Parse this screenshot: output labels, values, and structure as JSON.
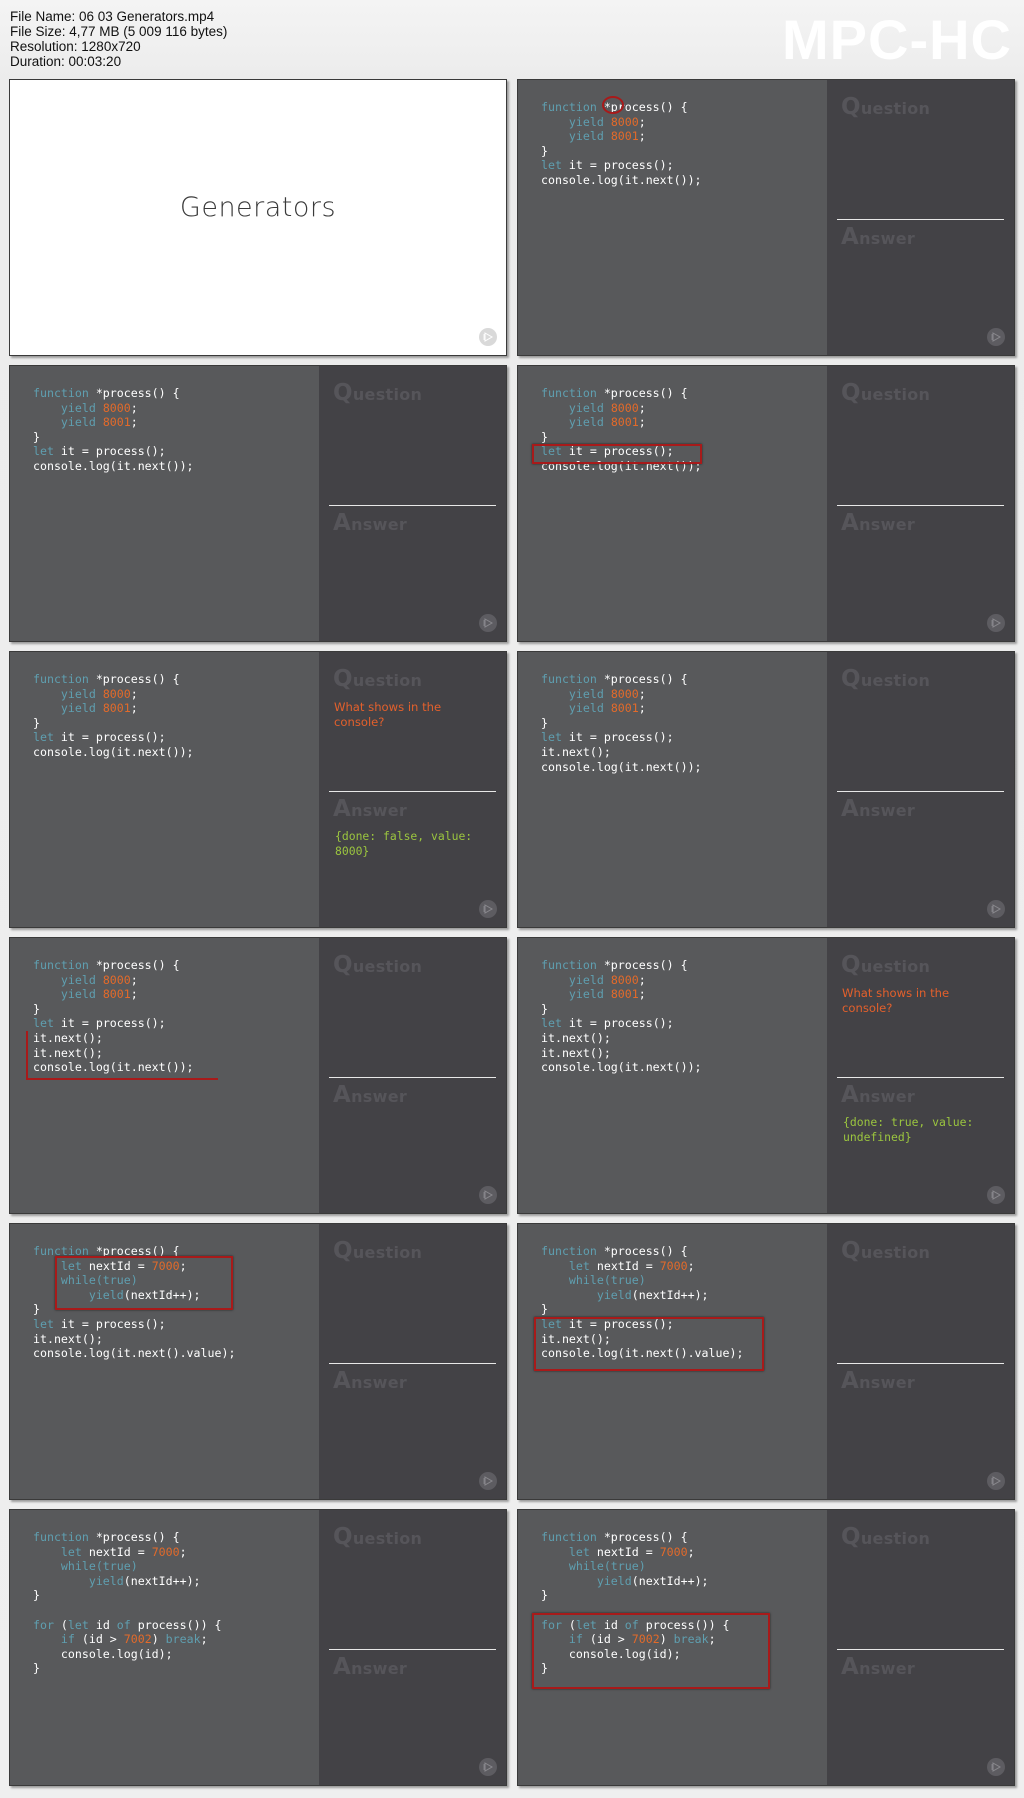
{
  "header": {
    "file_name": "File Name: 06 03 Generators.mp4",
    "file_size": "File Size: 4,77 MB (5 009 116 bytes)",
    "resolution": "Resolution: 1280x720",
    "duration": "Duration: 00:03:20",
    "logo": "MPC-HC"
  },
  "labels": {
    "question_initial": "Q",
    "question_rest": "uestion",
    "answer_initial": "A",
    "answer_rest": "nswer"
  },
  "colors": {
    "keyword": "#5f9fb0",
    "number": "#e36a2a",
    "question_text": "#e3602c",
    "answer_text": "#9bc53f",
    "highlight": "#a81a1a",
    "code_bg": "#58595b",
    "qa_bg": "#434246"
  },
  "title_slide": {
    "title": "Generators"
  },
  "frames": [
    {
      "code": [
        [
          [
            "kw",
            "function"
          ],
          [
            "t",
            " *process() {"
          ]
        ],
        [
          [
            "t",
            "    "
          ],
          [
            "kw",
            "yield"
          ],
          [
            "t",
            " "
          ],
          [
            "num",
            "8000"
          ],
          [
            "t",
            ";"
          ]
        ],
        [
          [
            "t",
            "    "
          ],
          [
            "kw",
            "yield"
          ],
          [
            "t",
            " "
          ],
          [
            "num",
            "8001"
          ],
          [
            "t",
            ";"
          ]
        ],
        [
          [
            "t",
            "}"
          ]
        ],
        [
          [
            "kw",
            "let"
          ],
          [
            "t",
            " it = process();"
          ]
        ],
        [
          [
            "t",
            "console.log(it.next());"
          ]
        ]
      ],
      "question": "",
      "answer": "",
      "highlight": "circle-star"
    },
    {
      "code": [
        [
          [
            "kw",
            "function"
          ],
          [
            "t",
            " *process() {"
          ]
        ],
        [
          [
            "t",
            "    "
          ],
          [
            "kw",
            "yield"
          ],
          [
            "t",
            " "
          ],
          [
            "num",
            "8000"
          ],
          [
            "t",
            ";"
          ]
        ],
        [
          [
            "t",
            "    "
          ],
          [
            "kw",
            "yield"
          ],
          [
            "t",
            " "
          ],
          [
            "num",
            "8001"
          ],
          [
            "t",
            ";"
          ]
        ],
        [
          [
            "t",
            "}"
          ]
        ],
        [
          [
            "kw",
            "let"
          ],
          [
            "t",
            " it = process();"
          ]
        ],
        [
          [
            "t",
            "console.log(it.next());"
          ]
        ]
      ],
      "question": "",
      "answer": "",
      "highlight": "none"
    },
    {
      "code": [
        [
          [
            "kw",
            "function"
          ],
          [
            "t",
            " *process() {"
          ]
        ],
        [
          [
            "t",
            "    "
          ],
          [
            "kw",
            "yield"
          ],
          [
            "t",
            " "
          ],
          [
            "num",
            "8000"
          ],
          [
            "t",
            ";"
          ]
        ],
        [
          [
            "t",
            "    "
          ],
          [
            "kw",
            "yield"
          ],
          [
            "t",
            " "
          ],
          [
            "num",
            "8001"
          ],
          [
            "t",
            ";"
          ]
        ],
        [
          [
            "t",
            "}"
          ]
        ],
        [
          [
            "kw",
            "let"
          ],
          [
            "t",
            " it = process();"
          ]
        ],
        [
          [
            "t",
            "console.log(it.next());"
          ]
        ]
      ],
      "question": "",
      "answer": "",
      "highlight": "box-let-line"
    },
    {
      "code": [
        [
          [
            "kw",
            "function"
          ],
          [
            "t",
            " *process() {"
          ]
        ],
        [
          [
            "t",
            "    "
          ],
          [
            "kw",
            "yield"
          ],
          [
            "t",
            " "
          ],
          [
            "num",
            "8000"
          ],
          [
            "t",
            ";"
          ]
        ],
        [
          [
            "t",
            "    "
          ],
          [
            "kw",
            "yield"
          ],
          [
            "t",
            " "
          ],
          [
            "num",
            "8001"
          ],
          [
            "t",
            ";"
          ]
        ],
        [
          [
            "t",
            "}"
          ]
        ],
        [
          [
            "kw",
            "let"
          ],
          [
            "t",
            " it = process();"
          ]
        ],
        [
          [
            "t",
            "console.log(it.next());"
          ]
        ]
      ],
      "question": "What shows in the console?",
      "answer": "{done: false, value: 8000}",
      "highlight": "none"
    },
    {
      "code": [
        [
          [
            "kw",
            "function"
          ],
          [
            "t",
            " *process() {"
          ]
        ],
        [
          [
            "t",
            "    "
          ],
          [
            "kw",
            "yield"
          ],
          [
            "t",
            " "
          ],
          [
            "num",
            "8000"
          ],
          [
            "t",
            ";"
          ]
        ],
        [
          [
            "t",
            "    "
          ],
          [
            "kw",
            "yield"
          ],
          [
            "t",
            " "
          ],
          [
            "num",
            "8001"
          ],
          [
            "t",
            ";"
          ]
        ],
        [
          [
            "t",
            "}"
          ]
        ],
        [
          [
            "kw",
            "let"
          ],
          [
            "t",
            " it = process();"
          ]
        ],
        [
          [
            "t",
            "it.next();"
          ]
        ],
        [
          [
            "t",
            "console.log(it.next());"
          ]
        ]
      ],
      "question": "",
      "answer": "",
      "highlight": "none"
    },
    {
      "code": [
        [
          [
            "kw",
            "function"
          ],
          [
            "t",
            " *process() {"
          ]
        ],
        [
          [
            "t",
            "    "
          ],
          [
            "kw",
            "yield"
          ],
          [
            "t",
            " "
          ],
          [
            "num",
            "8000"
          ],
          [
            "t",
            ";"
          ]
        ],
        [
          [
            "t",
            "    "
          ],
          [
            "kw",
            "yield"
          ],
          [
            "t",
            " "
          ],
          [
            "num",
            "8001"
          ],
          [
            "t",
            ";"
          ]
        ],
        [
          [
            "t",
            "}"
          ]
        ],
        [
          [
            "kw",
            "let"
          ],
          [
            "t",
            " it = process();"
          ]
        ],
        [
          [
            "t",
            "it.next();"
          ]
        ],
        [
          [
            "t",
            "it.next();"
          ]
        ],
        [
          [
            "t",
            "console.log(it.next());"
          ]
        ]
      ],
      "question": "",
      "answer": "",
      "highlight": "bracket-next-lines"
    },
    {
      "code": [
        [
          [
            "kw",
            "function"
          ],
          [
            "t",
            " *process() {"
          ]
        ],
        [
          [
            "t",
            "    "
          ],
          [
            "kw",
            "yield"
          ],
          [
            "t",
            " "
          ],
          [
            "num",
            "8000"
          ],
          [
            "t",
            ";"
          ]
        ],
        [
          [
            "t",
            "    "
          ],
          [
            "kw",
            "yield"
          ],
          [
            "t",
            " "
          ],
          [
            "num",
            "8001"
          ],
          [
            "t",
            ";"
          ]
        ],
        [
          [
            "t",
            "}"
          ]
        ],
        [
          [
            "kw",
            "let"
          ],
          [
            "t",
            " it = process();"
          ]
        ],
        [
          [
            "t",
            "it.next();"
          ]
        ],
        [
          [
            "t",
            "it.next();"
          ]
        ],
        [
          [
            "t",
            "console.log(it.next());"
          ]
        ]
      ],
      "question": "What shows in the console?",
      "answer": "{done: true, value: undefined}",
      "highlight": "none"
    },
    {
      "code": [
        [
          [
            "kw",
            "function"
          ],
          [
            "t",
            " *process() {"
          ]
        ],
        [
          [
            "t",
            "    "
          ],
          [
            "kw",
            "let"
          ],
          [
            "t",
            " nextId = "
          ],
          [
            "num",
            "7000"
          ],
          [
            "t",
            ";"
          ]
        ],
        [
          [
            "t",
            "    "
          ],
          [
            "kw",
            "while(true)"
          ]
        ],
        [
          [
            "t",
            "        "
          ],
          [
            "kw",
            "yield"
          ],
          [
            "t",
            "(nextId++);"
          ]
        ],
        [
          [
            "t",
            "}"
          ]
        ],
        [
          [
            "kw",
            "let"
          ],
          [
            "t",
            " it = process();"
          ]
        ],
        [
          [
            "t",
            "it.next();"
          ]
        ],
        [
          [
            "t",
            "console.log(it.next().value);"
          ]
        ]
      ],
      "question": "",
      "answer": "",
      "highlight": "box-body"
    },
    {
      "code": [
        [
          [
            "kw",
            "function"
          ],
          [
            "t",
            " *process() {"
          ]
        ],
        [
          [
            "t",
            "    "
          ],
          [
            "kw",
            "let"
          ],
          [
            "t",
            " nextId = "
          ],
          [
            "num",
            "7000"
          ],
          [
            "t",
            ";"
          ]
        ],
        [
          [
            "t",
            "    "
          ],
          [
            "kw",
            "while(true)"
          ]
        ],
        [
          [
            "t",
            "        "
          ],
          [
            "kw",
            "yield"
          ],
          [
            "t",
            "(nextId++);"
          ]
        ],
        [
          [
            "t",
            "}"
          ]
        ],
        [
          [
            "kw",
            "let"
          ],
          [
            "t",
            " it = process();"
          ]
        ],
        [
          [
            "t",
            "it.next();"
          ]
        ],
        [
          [
            "t",
            "console.log(it.next().value);"
          ]
        ]
      ],
      "question": "",
      "answer": "",
      "highlight": "box-calls"
    },
    {
      "code": [
        [
          [
            "kw",
            "function"
          ],
          [
            "t",
            " *process() {"
          ]
        ],
        [
          [
            "t",
            "    "
          ],
          [
            "kw",
            "let"
          ],
          [
            "t",
            " nextId = "
          ],
          [
            "num",
            "7000"
          ],
          [
            "t",
            ";"
          ]
        ],
        [
          [
            "t",
            "    "
          ],
          [
            "kw",
            "while(true)"
          ]
        ],
        [
          [
            "t",
            "        "
          ],
          [
            "kw",
            "yield"
          ],
          [
            "t",
            "(nextId++);"
          ]
        ],
        [
          [
            "t",
            "}"
          ]
        ],
        [
          [
            "t",
            ""
          ]
        ],
        [
          [
            "kw",
            "for"
          ],
          [
            "t",
            " ("
          ],
          [
            "kw",
            "let"
          ],
          [
            "t",
            " id "
          ],
          [
            "kw",
            "of"
          ],
          [
            "t",
            " process()) {"
          ]
        ],
        [
          [
            "t",
            "    "
          ],
          [
            "kw",
            "if"
          ],
          [
            "t",
            " (id > "
          ],
          [
            "num",
            "7002"
          ],
          [
            "t",
            ") "
          ],
          [
            "kw",
            "break"
          ],
          [
            "t",
            ";"
          ]
        ],
        [
          [
            "t",
            "    console.log(id);"
          ]
        ],
        [
          [
            "t",
            "}"
          ]
        ]
      ],
      "question": "",
      "answer": "",
      "highlight": "none"
    },
    {
      "code": [
        [
          [
            "kw",
            "function"
          ],
          [
            "t",
            " *process() {"
          ]
        ],
        [
          [
            "t",
            "    "
          ],
          [
            "kw",
            "let"
          ],
          [
            "t",
            " nextId = "
          ],
          [
            "num",
            "7000"
          ],
          [
            "t",
            ";"
          ]
        ],
        [
          [
            "t",
            "    "
          ],
          [
            "kw",
            "while(true)"
          ]
        ],
        [
          [
            "t",
            "        "
          ],
          [
            "kw",
            "yield"
          ],
          [
            "t",
            "(nextId++);"
          ]
        ],
        [
          [
            "t",
            "}"
          ]
        ],
        [
          [
            "t",
            ""
          ]
        ],
        [
          [
            "kw",
            "for"
          ],
          [
            "t",
            " ("
          ],
          [
            "kw",
            "let"
          ],
          [
            "t",
            " id "
          ],
          [
            "kw",
            "of"
          ],
          [
            "t",
            " process()) {"
          ]
        ],
        [
          [
            "t",
            "    "
          ],
          [
            "kw",
            "if"
          ],
          [
            "t",
            " (id > "
          ],
          [
            "num",
            "7002"
          ],
          [
            "t",
            ") "
          ],
          [
            "kw",
            "break"
          ],
          [
            "t",
            ";"
          ]
        ],
        [
          [
            "t",
            "    console.log(id);"
          ]
        ],
        [
          [
            "t",
            "}"
          ]
        ]
      ],
      "question": "",
      "answer": "",
      "highlight": "box-for-loop"
    }
  ]
}
